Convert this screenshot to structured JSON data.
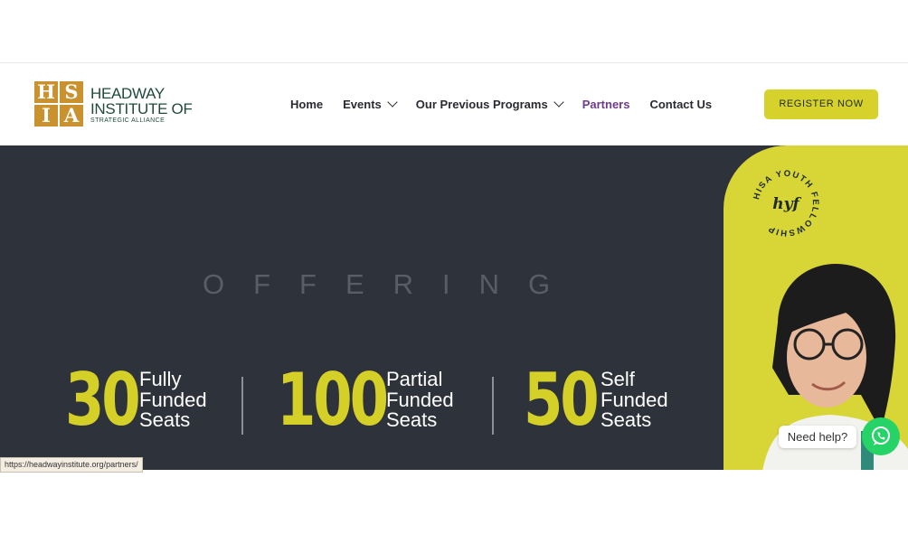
{
  "logo": {
    "letters": [
      "H",
      "S",
      "I",
      "A"
    ],
    "line1": "HEADWAY",
    "line2": "INSTITUTE OF",
    "line3": "STRATEGIC ALLIANCE"
  },
  "nav": {
    "items": [
      {
        "label": "Home",
        "dropdown": false
      },
      {
        "label": "Events",
        "dropdown": true
      },
      {
        "label": "Our Previous Programs",
        "dropdown": true
      },
      {
        "label": "Partners",
        "dropdown": false,
        "active": true
      },
      {
        "label": "Contact Us",
        "dropdown": false
      }
    ]
  },
  "register_label": "REGISTER NOW",
  "hero": {
    "offering": "OFFERING",
    "stats": [
      {
        "number": "30",
        "label": "Fully\nFunded\nSeats"
      },
      {
        "number": "100",
        "label": "Partial\nFunded\nSeats"
      },
      {
        "number": "50",
        "label": "Self\nFunded\nSeats"
      }
    ],
    "badge_ring_text": "HISA YOUTH FELLOWSHIP",
    "badge_center": "hyf"
  },
  "chat": {
    "need_help": "Need help?"
  },
  "status_url": "https://headwayinstitute.org/partners/",
  "colors": {
    "accent_yellow": "#d6d22b",
    "hero_bg": "#2e323a",
    "logo_gold": "#c9922e",
    "logo_green": "#1f4b3a",
    "active_nav": "#6d3b8c",
    "whatsapp": "#25d366"
  }
}
